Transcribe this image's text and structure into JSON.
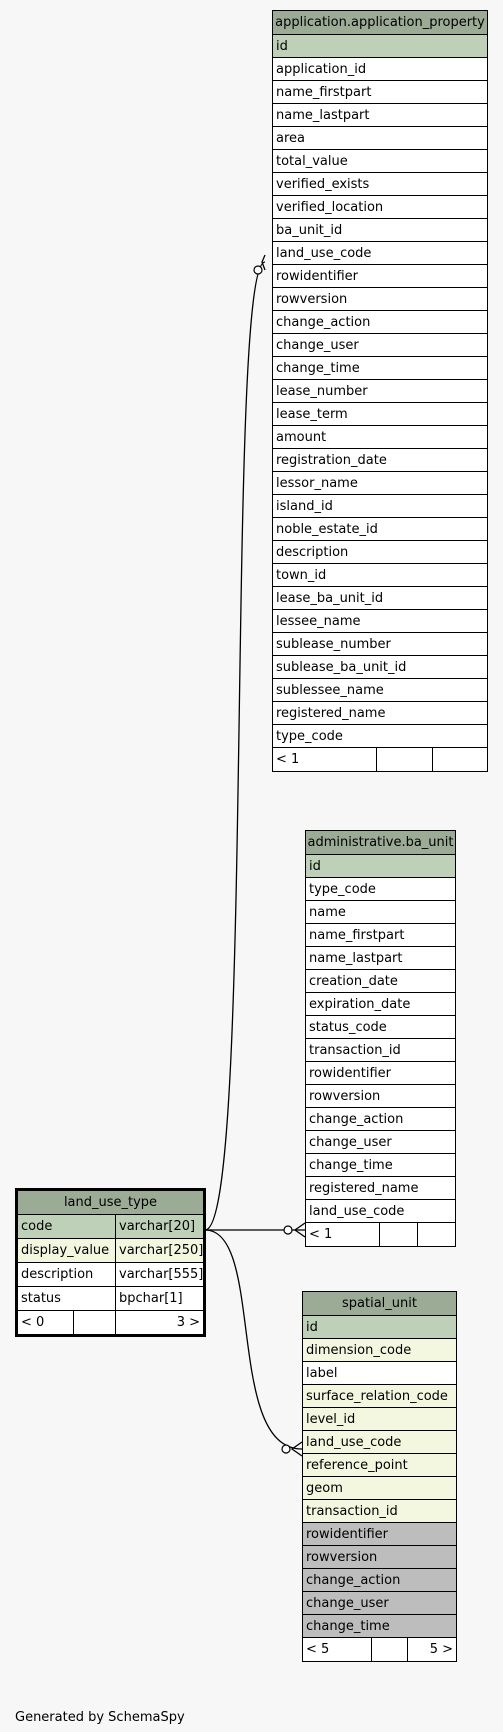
{
  "tables": {
    "application_property": {
      "title": "application.application_property",
      "columns": [
        "id",
        "application_id",
        "name_firstpart",
        "name_lastpart",
        "area",
        "total_value",
        "verified_exists",
        "verified_location",
        "ba_unit_id",
        "land_use_code",
        "rowidentifier",
        "rowversion",
        "change_action",
        "change_user",
        "change_time",
        "lease_number",
        "lease_term",
        "amount",
        "registration_date",
        "lessor_name",
        "island_id",
        "noble_estate_id",
        "description",
        "town_id",
        "lease_ba_unit_id",
        "lessee_name",
        "sublease_number",
        "sublease_ba_unit_id",
        "sublessee_name",
        "registered_name",
        "type_code"
      ],
      "footer": [
        "< 1",
        "",
        ""
      ]
    },
    "ba_unit": {
      "title": "administrative.ba_unit",
      "columns": [
        "id",
        "type_code",
        "name",
        "name_firstpart",
        "name_lastpart",
        "creation_date",
        "expiration_date",
        "status_code",
        "transaction_id",
        "rowidentifier",
        "rowversion",
        "change_action",
        "change_user",
        "change_time",
        "registered_name",
        "land_use_code"
      ],
      "footer": [
        "< 1",
        "",
        ""
      ]
    },
    "land_use_type": {
      "title": "land_use_type",
      "columns": [
        {
          "name": "code",
          "type": "varchar[20]"
        },
        {
          "name": "display_value",
          "type": "varchar[250]"
        },
        {
          "name": "description",
          "type": "varchar[555]"
        },
        {
          "name": "status",
          "type": "bpchar[1]"
        }
      ],
      "footer": [
        "< 0",
        "",
        "3 >"
      ]
    },
    "spatial_unit": {
      "title": "spatial_unit",
      "columns": [
        "id",
        "dimension_code",
        "label",
        "surface_relation_code",
        "level_id",
        "land_use_code",
        "reference_point",
        "geom",
        "transaction_id",
        "rowidentifier",
        "rowversion",
        "change_action",
        "change_user",
        "change_time"
      ],
      "footer": [
        "< 5",
        "",
        "5 >"
      ]
    }
  },
  "footer_text": "Generated by SchemaSpy"
}
